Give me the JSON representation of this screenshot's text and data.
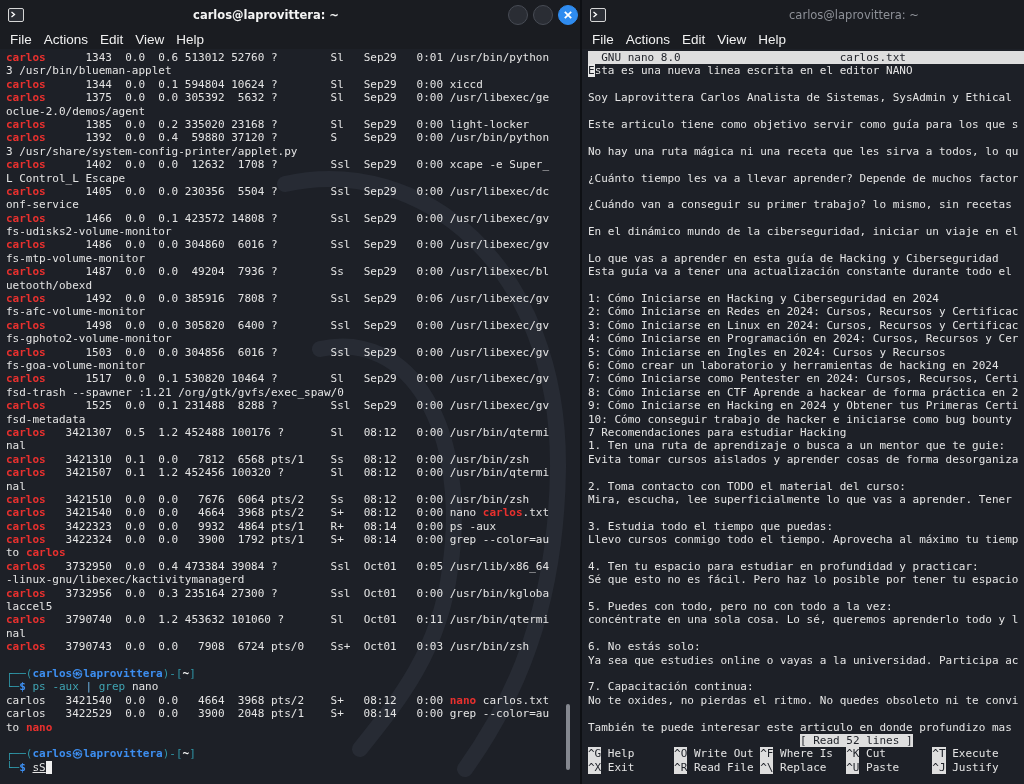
{
  "windows": [
    {
      "kind": "terminal",
      "title": "carlos@laprovittera: ~",
      "active": true,
      "window_buttons": [
        {
          "kind": "minimize"
        },
        {
          "kind": "maximize"
        },
        {
          "kind": "close"
        }
      ],
      "menu": [
        "File",
        "Actions",
        "Edit",
        "View",
        "Help"
      ],
      "output": [
        "**carlos**      1343  0.0  0.6 513012 52760 ?        Sl   Sep29   0:01 /usr/bin/python",
        "3 /usr/bin/blueman-applet",
        "**carlos**      1344  0.0  0.1 594804 10624 ?        Sl   Sep29   0:00 xiccd",
        "**carlos**      1375  0.0  0.0 305392  5632 ?        Sl   Sep29   0:00 /usr/libexec/ge",
        "oclue-2.0/demos/agent",
        "**carlos**      1385  0.0  0.2 335020 23168 ?        Sl   Sep29   0:00 light-locker",
        "**carlos**      1392  0.0  0.4  59880 37120 ?        S    Sep29   0:00 /usr/bin/python",
        "3 /usr/share/system-config-printer/applet.py",
        "**carlos**      1402  0.0  0.0  12632  1708 ?        Ssl  Sep29   0:00 xcape -e Super_",
        "L Control_L Escape",
        "**carlos**      1405  0.0  0.0 230356  5504 ?        Ssl  Sep29   0:00 /usr/libexec/dc",
        "onf-service",
        "**carlos**      1466  0.0  0.1 423572 14808 ?        Ssl  Sep29   0:00 /usr/libexec/gv",
        "fs-udisks2-volume-monitor",
        "**carlos**      1486  0.0  0.0 304860  6016 ?        Ssl  Sep29   0:00 /usr/libexec/gv",
        "fs-mtp-volume-monitor",
        "**carlos**      1487  0.0  0.0  49204  7936 ?        Ss   Sep29   0:00 /usr/libexec/bl",
        "uetooth/obexd",
        "**carlos**      1492  0.0  0.0 385916  7808 ?        Ssl  Sep29   0:06 /usr/libexec/gv",
        "fs-afc-volume-monitor",
        "**carlos**      1498  0.0  0.0 305820  6400 ?        Ssl  Sep29   0:00 /usr/libexec/gv",
        "fs-gphoto2-volume-monitor",
        "**carlos**      1503  0.0  0.0 304856  6016 ?        Ssl  Sep29   0:00 /usr/libexec/gv",
        "fs-goa-volume-monitor",
        "**carlos**      1517  0.0  0.1 530820 10464 ?        Sl   Sep29   0:00 /usr/libexec/gv",
        "fsd-trash --spawner :1.21 /org/gtk/gvfs/exec_spaw/0",
        "**carlos**      1525  0.0  0.1 231488  8288 ?        Ssl  Sep29   0:00 /usr/libexec/gv",
        "fsd-metadata",
        "**carlos**   3421307  0.5  1.2 452488 100176 ?       Sl   08:12   0:00 /usr/bin/qtermi",
        "nal",
        "**carlos**   3421310  0.1  0.0   7812  6568 pts/1    Ss   08:12   0:00 /usr/bin/zsh",
        "**carlos**   3421507  0.1  1.2 452456 100320 ?       Sl   08:12   0:00 /usr/bin/qtermi",
        "nal",
        "**carlos**   3421510  0.0  0.0   7676  6064 pts/2    Ss   08:12   0:00 /usr/bin/zsh",
        "**carlos**   3421540  0.0  0.0   4664  3968 pts/2    S+   08:12   0:00 nano **carlos**.txt",
        "**carlos**   3422323  0.0  0.0   9932  4864 pts/1    R+   08:14   0:00 ps -aux",
        "**carlos**   3422324  0.0  0.0   3900  1792 pts/1    S+   08:14   0:00 grep --color=au",
        "to **carlos**",
        "**carlos**   3732950  0.0  0.4 473384 39084 ?        Ssl  Oct01   0:05 /usr/lib/x86_64",
        "-linux-gnu/libexec/kactivitymanagerd",
        "**carlos**   3732956  0.0  0.3 235164 27300 ?        Ssl  Oct01   0:00 /usr/bin/kgloba",
        "laccel5",
        "**carlos**   3790740  0.0  1.2 453632 101060 ?       Sl   Oct01   0:11 /usr/bin/qtermi",
        "nal",
        "**carlos**   3790743  0.0  0.0   7908  6724 pts/0    Ss+  Oct01   0:03 /usr/bin/zsh"
      ],
      "sessions": [
        {
          "prompt": [
            {
              "text": "┌──(",
              "kind": "frame"
            },
            {
              "text": "carlos㉿laprovittera",
              "kind": "identity"
            },
            {
              "text": ")-[",
              "kind": "frame"
            },
            {
              "text": "~",
              "kind": "cwd"
            },
            {
              "text": "]",
              "kind": "frame"
            }
          ],
          "command": {
            "lead": "└─",
            "sigil": "$",
            "tokens": [
              {
                "text": "ps",
                "kind": "command"
              },
              {
                "text": "-aux",
                "kind": "option"
              },
              {
                "text": "|",
                "kind": "separator"
              },
              {
                "text": "grep",
                "kind": "command"
              },
              {
                "text": "nano",
                "kind": "argument"
              }
            ]
          },
          "cursor": false,
          "output": [
            "carlos   3421540  0.0  0.0   4664  3968 pts/2    S+   08:12   0:00 **nano** carlos.txt",
            "carlos   3422529  0.0  0.0   3900  2048 pts/1    S+   08:14   0:00 grep --color=au",
            "to **nano**"
          ]
        },
        {
          "prompt": [
            {
              "text": "┌──(",
              "kind": "frame"
            },
            {
              "text": "carlos㉿laprovittera",
              "kind": "identity"
            },
            {
              "text": ")-[",
              "kind": "frame"
            },
            {
              "text": "~",
              "kind": "cwd"
            },
            {
              "text": "]",
              "kind": "frame"
            }
          ],
          "command": {
            "lead": "└─",
            "sigil": "$",
            "tokens": [
              {
                "text": "sS",
                "kind": "path"
              }
            ]
          },
          "cursor": true
        }
      ]
    },
    {
      "kind": "editor",
      "title": "carlos@laprovittera: ~",
      "active": false,
      "menu": [
        "File",
        "Actions",
        "Edit",
        "View",
        "Help"
      ],
      "editor": {
        "name": "GNU nano 8.0",
        "file": "carlos.txt",
        "cursor": true,
        "paragraphs": [
          [
            "Esta es una nueva linea escrita en el editor NANO"
          ],
          [
            "Soy Laprovittera Carlos Analista de Sistemas, SysAdmin y Ethical"
          ],
          [
            "Este articulo tiene como objetivo servir como guía para los que s"
          ],
          [
            "No hay una ruta mágica ni una receta que les sirva a todos, lo qu"
          ],
          [
            "¿Cuánto tiempo les va a llevar aprender? Depende de muchos factor"
          ],
          [
            "¿Cuándo van a conseguir su primer trabajo? lo mismo, sin recetas"
          ],
          [
            "En el dinámico mundo de la ciberseguridad, iniciar un viaje en el"
          ],
          [
            "Lo que vas a aprender en esta guía de Hacking y Ciberseguridad",
            "Esta guía va a tener una actualización constante durante todo el"
          ],
          [
            "1: Cómo Iniciarse en Hacking y Ciberseguridad en 2024",
            "2: Cómo Iniciarse en Redes en 2024: Cursos, Recursos y Certificac",
            "3: Cómo Iniciarse en Linux en 2024: Cursos, Recursos y Certificac",
            "4: Cómo Iniciarse en Programación en 2024: Cursos, Recursos y Cer",
            "5: Cómo Iniciarse en Ingles en 2024: Cursos y Recursos",
            "6: Cómo crear un laboratorio y herramientas de hacking en 2024",
            "7: Cómo Iniciarse como Pentester en 2024: Cursos, Recursos, Certi",
            "8: Cómo Iniciarse en CTF Aprende a hackear de forma práctica en 2",
            "9: Cómo Iniciarse en Hacking en 2024 y Obtener tus Primeras Certi",
            "10: Cómo conseguir trabajo de hacker e iniciarse como bug bounty",
            "7 Recomendaciones para estudiar Hacking",
            "1. Ten una ruta de aprendizaje o busca a un mentor que te guie:",
            "Evita tomar cursos aislados y aprender cosas de forma desorganiza"
          ],
          [
            "2. Toma contacto con TODO el material del curso:",
            "Mira, escucha, lee superficialmente lo que vas a aprender. Tener"
          ],
          [
            "3. Estudia todo el tiempo que puedas:",
            "Llevo cursos conmigo todo el tiempo. Aprovecha al máximo tu tiemp"
          ],
          [
            "4. Ten tu espacio para estudiar en profundidad y practicar:",
            "Sé que esto no es fácil. Pero haz lo posible por tener tu espacio"
          ],
          [
            "5. Puedes con todo, pero no con todo a la vez:",
            "concéntrate en una sola cosa. Lo sé, queremos aprenderlo todo y l"
          ],
          [
            "6. No estás solo:",
            "Ya sea que estudies online o vayas a la universidad. Participa ac"
          ],
          [
            "7. Capacitación continua:",
            "No te oxides, no pierdas el ritmo. No quedes obsoleto ni te convi"
          ],
          [
            "También te puede interesar este articulo en donde profundizo mas"
          ]
        ],
        "status": "[ Read 52 lines ]",
        "shortcuts": [
          [
            {
              "key": "^G",
              "label": "Help"
            },
            {
              "key": "^O",
              "label": "Write Out"
            },
            {
              "key": "^F",
              "label": "Where Is"
            },
            {
              "key": "^K",
              "label": "Cut"
            },
            {
              "key": "^T",
              "label": "Execute"
            }
          ],
          [
            {
              "key": "^X",
              "label": "Exit"
            },
            {
              "key": "^R",
              "label": "Read File"
            },
            {
              "key": "^\\",
              "label": "Replace"
            },
            {
              "key": "^U",
              "label": "Paste"
            },
            {
              "key": "^J",
              "label": "Justify"
            }
          ]
        ]
      }
    }
  ]
}
